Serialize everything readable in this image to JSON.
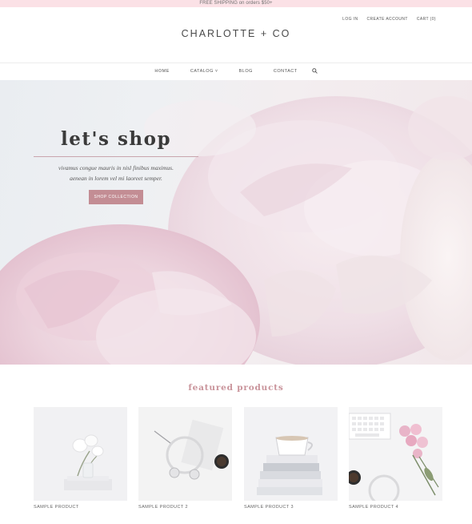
{
  "promo": {
    "text": "FREE SHIPPING on orders $50+"
  },
  "account": {
    "login": "LOG IN",
    "create_account": "CREATE ACCOUNT",
    "cart": "CART (0)"
  },
  "brand": {
    "logo": "CHARLOTTE + CO"
  },
  "nav": {
    "home": "HOME",
    "catalog": "CATALOG ˅",
    "blog": "BLOG",
    "contact": "CONTACT"
  },
  "hero": {
    "title": "let's shop",
    "subtitle_line1": "vivamus congue mauris in nisl finibus maximus.",
    "subtitle_line2": "aenean in lorem vel mi laoreet semper.",
    "button": "SHOP COLLECTION"
  },
  "featured": {
    "title": "featured products",
    "products": [
      {
        "name": "SAMPLE PRODUCT"
      },
      {
        "name": "SAMPLE PRODUCT 2"
      },
      {
        "name": "SAMPLE PRODUCT 3"
      },
      {
        "name": "SAMPLE PRODUCT 4"
      }
    ]
  },
  "colors": {
    "promo_bg": "#fbe1e6",
    "accent": "#c38d94",
    "featured_title": "#c9949b"
  },
  "icons": {
    "search": "search-icon"
  }
}
